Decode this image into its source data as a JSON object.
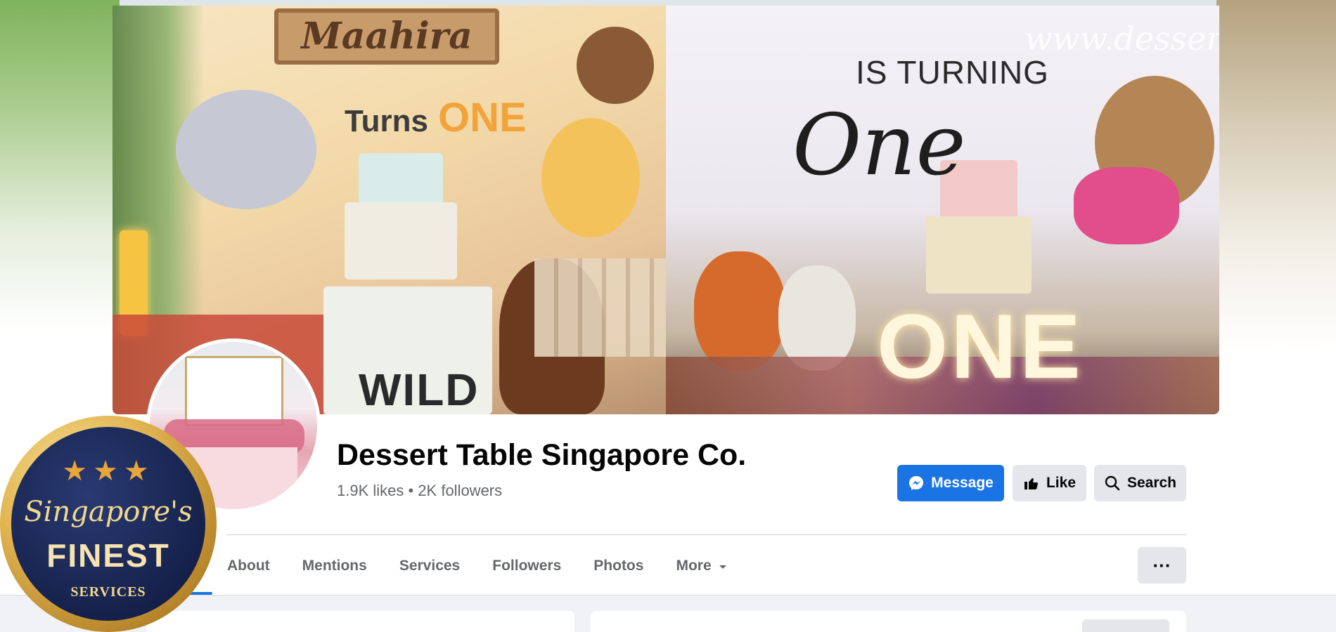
{
  "cover": {
    "left_image": {
      "sign_text": "Maahira",
      "headline_prefix": "Turns",
      "headline_number": "ONE",
      "banner_text": "WILD"
    },
    "right_image": {
      "watermark": "www.dessert",
      "headline": "IS TURNING",
      "script_text": "One",
      "marquee_text": "ONE"
    }
  },
  "page": {
    "name": "Dessert Table Singapore Co.",
    "stats": "1.9K likes • 2K followers"
  },
  "actions": {
    "message_label": "Message",
    "like_label": "Like",
    "search_label": "Search"
  },
  "tabs": [
    {
      "label": "About"
    },
    {
      "label": "Mentions"
    },
    {
      "label": "Services"
    },
    {
      "label": "Followers"
    },
    {
      "label": "Photos"
    },
    {
      "label": "More"
    }
  ],
  "more_options_label": "···",
  "badge": {
    "stars": "★★★",
    "script": "Singapore's",
    "title": "FINEST",
    "subtitle": "SERVICES"
  },
  "colors": {
    "accent": "#1b74e4",
    "secondary_button": "#e4e6eb",
    "text_primary": "#050505",
    "text_secondary": "#65676b",
    "page_background": "#f0f2f5"
  },
  "icons": {
    "message_button": "messenger-icon",
    "like_button": "thumbs-up-icon",
    "search_button": "search-icon",
    "more_tab": "caret-down-icon",
    "options_button": "ellipsis-icon"
  }
}
